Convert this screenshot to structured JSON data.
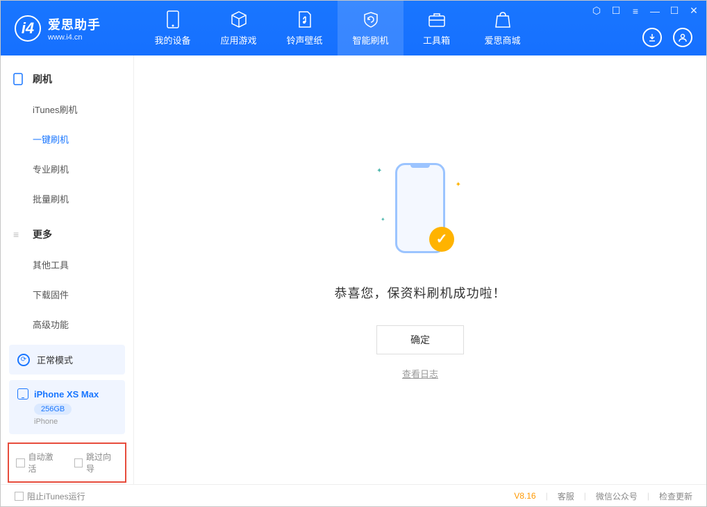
{
  "app": {
    "name": "爱思助手",
    "url": "www.i4.cn"
  },
  "nav": {
    "tabs": [
      {
        "id": "device",
        "label": "我的设备"
      },
      {
        "id": "apps",
        "label": "应用游戏"
      },
      {
        "id": "ring",
        "label": "铃声壁纸"
      },
      {
        "id": "flash",
        "label": "智能刷机",
        "active": true
      },
      {
        "id": "tools",
        "label": "工具箱"
      },
      {
        "id": "store",
        "label": "爱思商城"
      }
    ]
  },
  "sidebar": {
    "section1": {
      "title": "刷机",
      "items": [
        {
          "label": "iTunes刷机"
        },
        {
          "label": "一键刷机",
          "active": true
        },
        {
          "label": "专业刷机"
        },
        {
          "label": "批量刷机"
        }
      ]
    },
    "section2": {
      "title": "更多",
      "items": [
        {
          "label": "其他工具"
        },
        {
          "label": "下载固件"
        },
        {
          "label": "高级功能"
        }
      ]
    },
    "mode": "正常模式",
    "device": {
      "name": "iPhone XS Max",
      "capacity": "256GB",
      "type": "iPhone"
    },
    "checks": {
      "auto_activate": "自动激活",
      "skip_guide": "跳过向导"
    }
  },
  "main": {
    "success": "恭喜您，保资料刷机成功啦！",
    "ok": "确定",
    "view_log": "查看日志"
  },
  "footer": {
    "block_itunes": "阻止iTunes运行",
    "version": "V8.16",
    "links": {
      "service": "客服",
      "wechat": "微信公众号",
      "update": "检查更新"
    }
  }
}
